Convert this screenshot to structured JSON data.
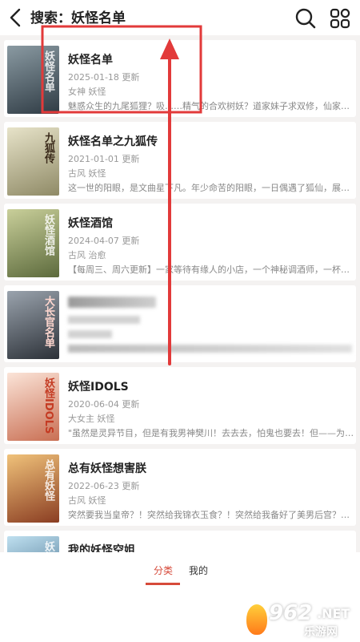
{
  "header": {
    "title": "搜索：妖怪名单"
  },
  "books": [
    {
      "title": "妖怪名单",
      "date": "2025-01-18 更新",
      "tags": "女神 妖怪",
      "desc": "魅惑众生的九尾狐狸？吸……精气的合欢树妖？道家妹子求双修，仙家女神……",
      "cover_text": "妖怪名单",
      "cover_color": "#5a6a72"
    },
    {
      "title": "妖怪名单之九狐传",
      "date": "2021-01-01 更新",
      "tags": "古风 妖怪",
      "desc": "这一世的阳眼，是文曲星下凡。年少命苦的阳眼，一日偶遇了狐仙，展开……",
      "cover_text": "九狐传",
      "cover_color": "#c9c2a2"
    },
    {
      "title": "妖怪酒馆",
      "date": "2024-04-07 更新",
      "tags": "古风 治愈",
      "desc": "【每周三、周六更新】一家等待有缘人的小店，一个神秘调酒师，一杯化……",
      "cover_text": "妖怪酒馆",
      "cover_color": "#8f9a6a"
    },
    {
      "title": "",
      "date": "",
      "tags": "",
      "desc": "",
      "cover_text": "大长官名单",
      "cover_color": "#4d5560"
    },
    {
      "title": "妖怪IDOLS",
      "date": "2020-06-04 更新",
      "tags": "大女主 妖怪",
      "desc": "\"虽然是灵异节目，但是有我男神樊川！去去去，怕鬼也要去！但——为什……",
      "cover_text": "妖怪IDOLS",
      "cover_color": "#e9b29c"
    },
    {
      "title": "总有妖怪想害朕",
      "date": "2022-06-23 更新",
      "tags": "古风 妖怪",
      "desc": "突然要我当皇帝？！突然给我锦衣玉食？！突然给我备好了美男后宫？！……",
      "cover_text": "总有妖怪",
      "cover_color": "#c77a45"
    },
    {
      "title": "我的妖怪空姐",
      "date": "",
      "tags": "",
      "desc": "",
      "cover_text": "妖怪空姐",
      "cover_color": "#3f6f93"
    }
  ],
  "tabs": [
    {
      "label": "分类"
    },
    {
      "label": "我的"
    }
  ],
  "watermark": {
    "brand": "962",
    "suffix": ".NET",
    "subtitle": "乐游网"
  },
  "colors": {
    "accent": "#d64a3a",
    "annotation": "#e23a3a"
  },
  "icons": {
    "back": "back-arrow-icon",
    "search": "search-icon",
    "grid": "grid-icon"
  }
}
